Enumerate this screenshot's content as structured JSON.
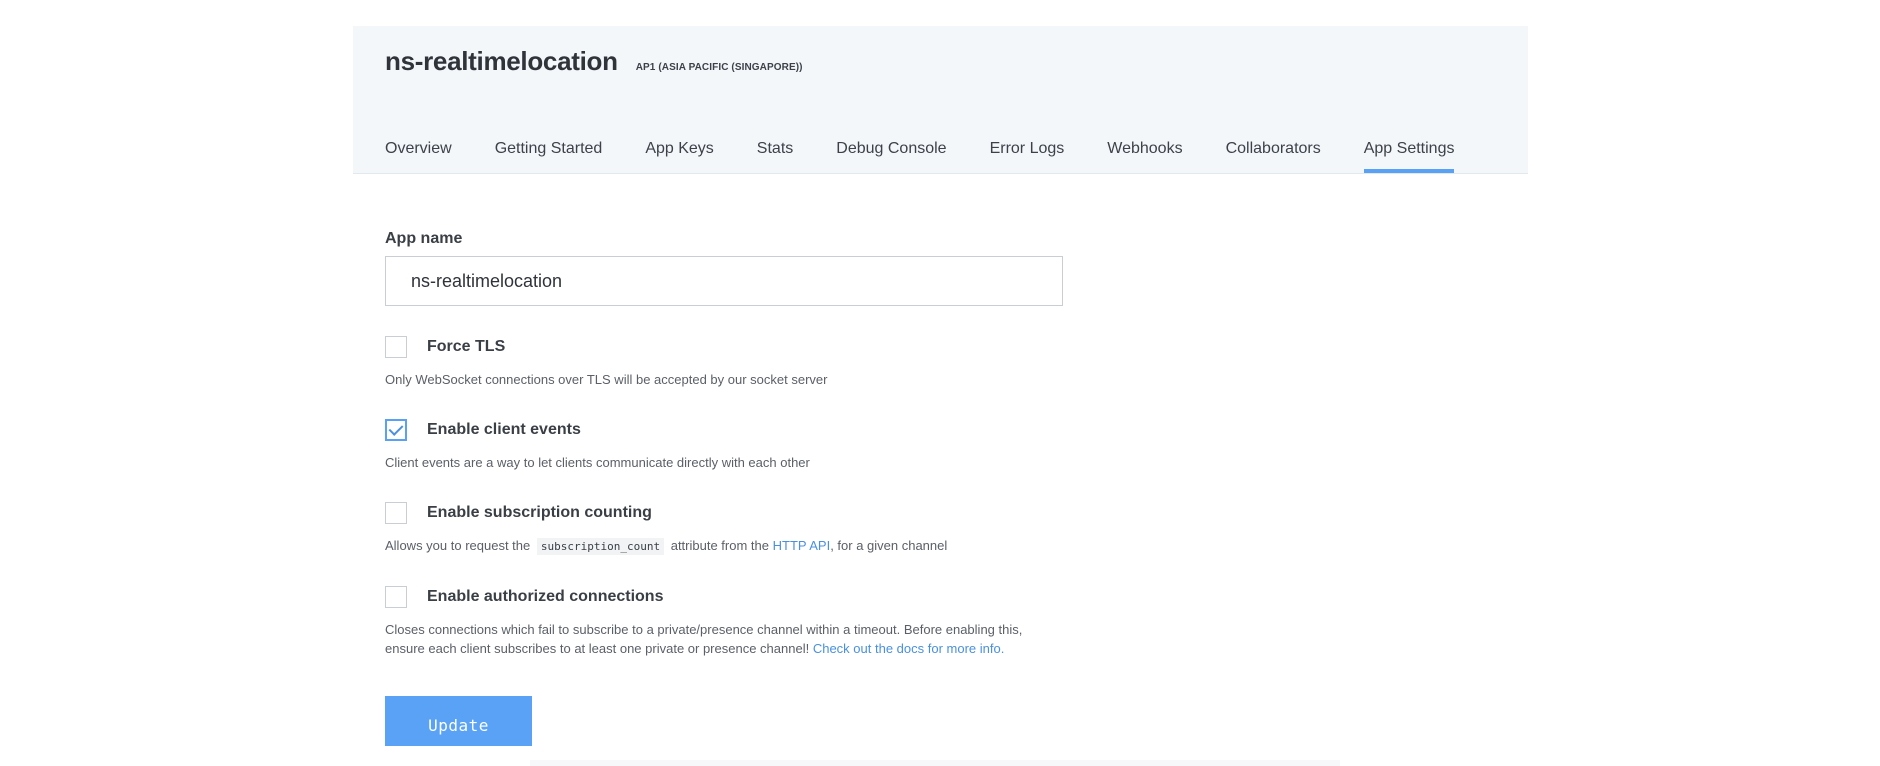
{
  "app": {
    "name": "ns-realtimelocation",
    "cluster": "AP1 (ASIA PACIFIC (SINGAPORE))"
  },
  "tabs": [
    {
      "label": "Overview",
      "active": false
    },
    {
      "label": "Getting Started",
      "active": false
    },
    {
      "label": "App Keys",
      "active": false
    },
    {
      "label": "Stats",
      "active": false
    },
    {
      "label": "Debug Console",
      "active": false
    },
    {
      "label": "Error Logs",
      "active": false
    },
    {
      "label": "Webhooks",
      "active": false
    },
    {
      "label": "Collaborators",
      "active": false
    },
    {
      "label": "App Settings",
      "active": true
    }
  ],
  "form": {
    "app_name_label": "App name",
    "app_name_value": "ns-realtimelocation",
    "options": {
      "force_tls": {
        "title": "Force TLS",
        "checked": false,
        "desc": "Only WebSocket connections over TLS will be accepted by our socket server"
      },
      "client_events": {
        "title": "Enable client events",
        "checked": true,
        "desc": "Client events are a way to let clients communicate directly with each other"
      },
      "subscription_counting": {
        "title": "Enable subscription counting",
        "checked": false,
        "desc_before": "Allows you to request the",
        "desc_code": "subscription_count",
        "desc_middle": "attribute from the",
        "desc_link": "HTTP API",
        "desc_after": ", for a given channel"
      },
      "authorized_connections": {
        "title": "Enable authorized connections",
        "checked": false,
        "desc_line1": "Closes connections which fail to subscribe to a private/presence channel within a timeout. Before enabling this,",
        "desc_line2": "ensure each client subscribes to at least one private or presence channel!",
        "desc_link": "Check out the docs for more info."
      }
    },
    "update_label": "Update"
  },
  "colors": {
    "accent": "#58a1f5",
    "header_bg": "#f4f7fa",
    "link": "#4a90e2",
    "button_bg": "#5aa2f5"
  }
}
